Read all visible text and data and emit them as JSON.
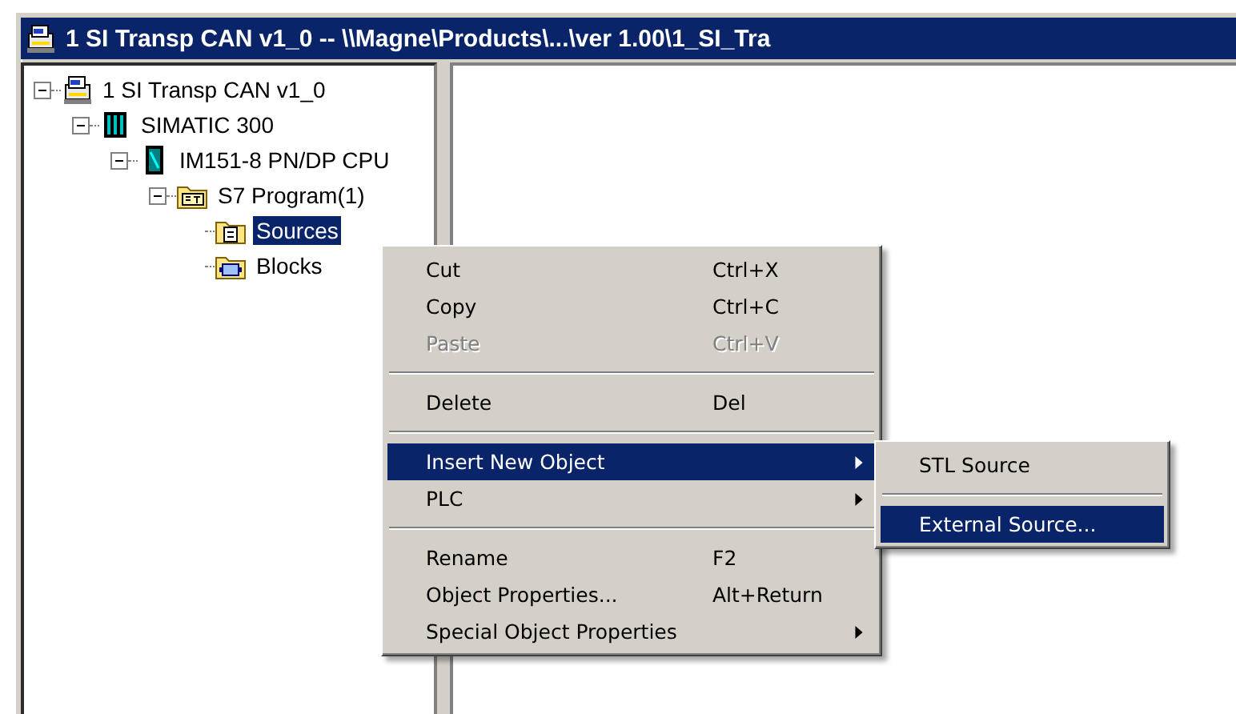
{
  "window": {
    "title": "1 SI Transp CAN v1_0 -- \\\\Magne\\Products\\...\\ver 1.00\\1_SI_Tra"
  },
  "tree": [
    {
      "label": "1 SI Transp CAN v1_0",
      "kind": "project",
      "expanded": true,
      "selected": false,
      "children": [
        {
          "label": "SIMATIC 300",
          "kind": "station",
          "expanded": true,
          "selected": false,
          "children": [
            {
              "label": "IM151-8 PN/DP CPU",
              "kind": "cpu",
              "expanded": true,
              "selected": false,
              "children": [
                {
                  "label": "S7 Program(1)",
                  "kind": "program",
                  "expanded": true,
                  "selected": false,
                  "children": [
                    {
                      "label": "Sources",
                      "kind": "sources",
                      "selected": true
                    },
                    {
                      "label": "Blocks",
                      "kind": "blocks",
                      "selected": false
                    }
                  ]
                }
              ]
            }
          ]
        }
      ]
    }
  ],
  "context_menu": [
    {
      "kind": "item",
      "label": "Cut",
      "shortcut": "Ctrl+X",
      "disabled": false,
      "submenu": false,
      "selected": false
    },
    {
      "kind": "item",
      "label": "Copy",
      "shortcut": "Ctrl+C",
      "disabled": false,
      "submenu": false,
      "selected": false
    },
    {
      "kind": "item",
      "label": "Paste",
      "shortcut": "Ctrl+V",
      "disabled": true,
      "submenu": false,
      "selected": false
    },
    {
      "kind": "separator"
    },
    {
      "kind": "item",
      "label": "Delete",
      "shortcut": "Del",
      "disabled": false,
      "submenu": false,
      "selected": false
    },
    {
      "kind": "separator"
    },
    {
      "kind": "item",
      "label": "Insert New Object",
      "disabled": false,
      "submenu": true,
      "selected": true
    },
    {
      "kind": "item",
      "label": "PLC",
      "disabled": false,
      "submenu": true,
      "selected": false
    },
    {
      "kind": "separator"
    },
    {
      "kind": "item",
      "label": "Rename",
      "shortcut": "F2",
      "disabled": false,
      "submenu": false,
      "selected": false
    },
    {
      "kind": "item",
      "label": "Object Properties...",
      "shortcut": "Alt+Return",
      "disabled": false,
      "submenu": false,
      "selected": false
    },
    {
      "kind": "item",
      "label": "Special Object Properties",
      "disabled": false,
      "submenu": true,
      "selected": false
    }
  ],
  "submenu": [
    {
      "kind": "item",
      "label": "STL Source",
      "disabled": false,
      "submenu": false,
      "selected": false
    },
    {
      "kind": "separator"
    },
    {
      "kind": "item",
      "label": "External Source...",
      "disabled": false,
      "submenu": false,
      "selected": true
    }
  ]
}
